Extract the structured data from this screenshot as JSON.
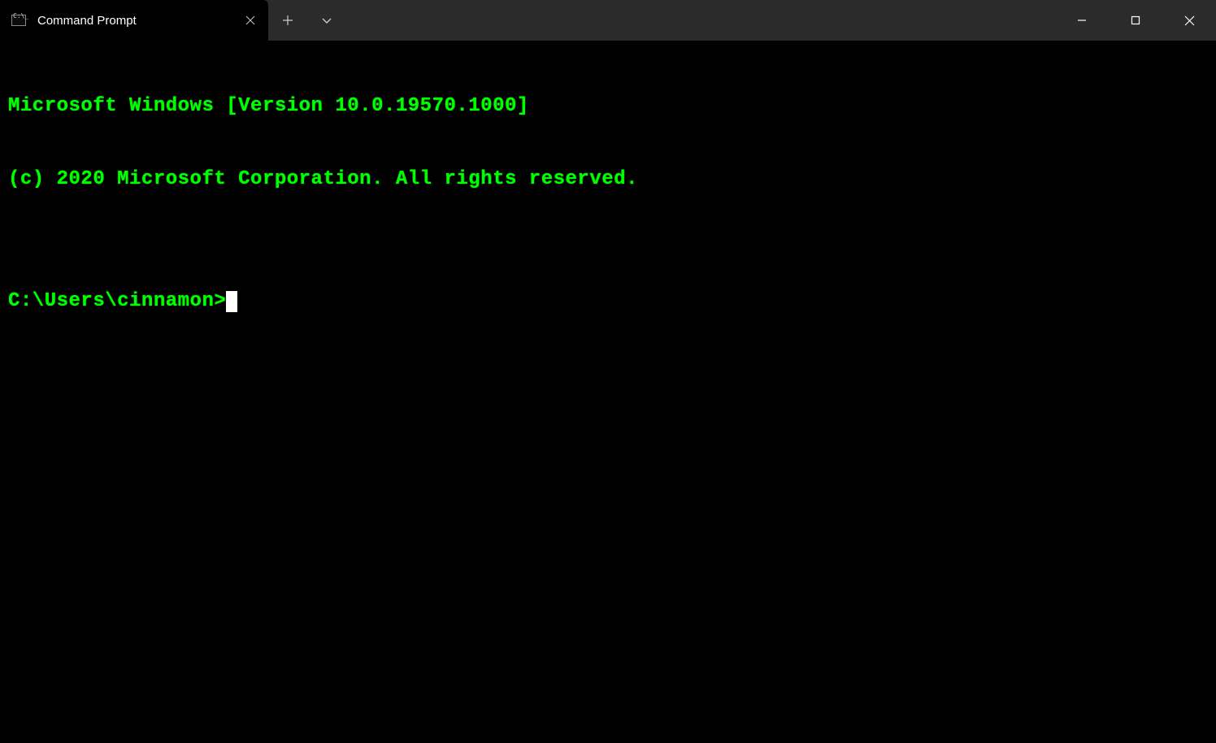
{
  "titlebar": {
    "tab": {
      "title": "Command Prompt"
    }
  },
  "terminal": {
    "line1": "Microsoft Windows [Version 10.0.19570.1000]",
    "line2": "(c) 2020 Microsoft Corporation. All rights reserved.",
    "blank": "",
    "prompt": "C:\\Users\\cinnamon>"
  }
}
